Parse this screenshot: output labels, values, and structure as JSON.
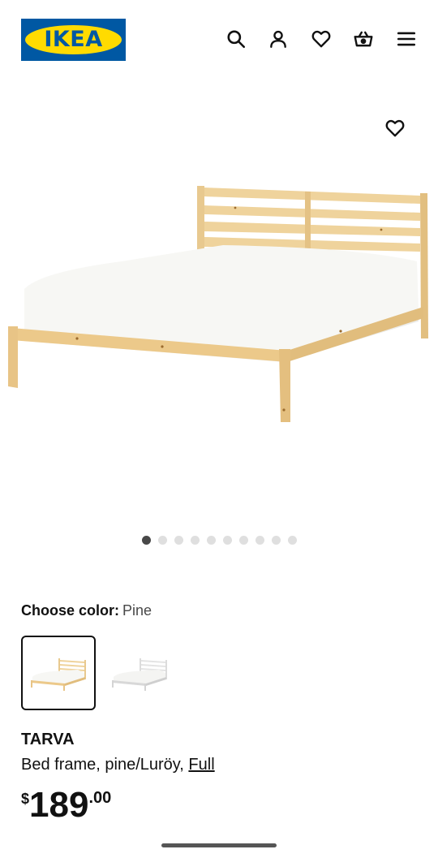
{
  "header": {
    "logo_text": "IKEA",
    "icons": [
      "search-icon",
      "account-icon",
      "heart-icon",
      "basket-icon",
      "menu-icon"
    ]
  },
  "gallery": {
    "image_count": 10,
    "active_index": 0
  },
  "color": {
    "label": "Choose color:",
    "selected": "Pine",
    "options": [
      "Pine",
      "White"
    ]
  },
  "product": {
    "name": "TARVA",
    "description": "Bed frame, pine/Luröy,",
    "size": "Full",
    "price": {
      "currency": "$",
      "integer": "189",
      "decimals": ".00"
    }
  },
  "colors": {
    "ikea_blue": "#0058a3",
    "ikea_yellow": "#ffdb00",
    "pine": "#ecc98a",
    "mattress": "#f7f7f4"
  }
}
